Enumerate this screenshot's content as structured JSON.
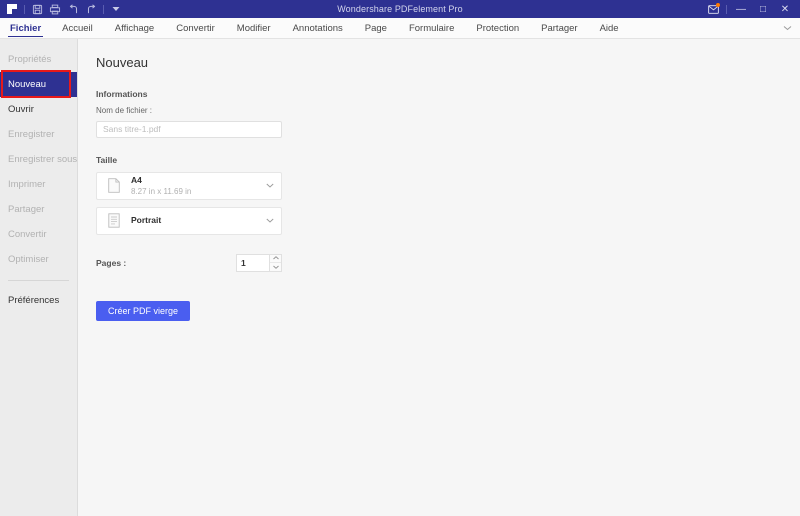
{
  "titlebar": {
    "app_title": "Wondershare PDFelement Pro",
    "quick_icons": [
      {
        "name": "app-logo-icon",
        "label": "PDFelement"
      },
      {
        "name": "save-icon",
        "label": "Enregistrer"
      },
      {
        "name": "print-icon",
        "label": "Imprimer"
      },
      {
        "name": "undo-icon",
        "label": "Annuler"
      },
      {
        "name": "redo-icon",
        "label": "Rétablir"
      },
      {
        "name": "quick-access-dropdown-icon",
        "label": "Personnaliser"
      }
    ],
    "mail_icon": "mail-icon",
    "notification_badge_color": "#ff7a00",
    "minimize_label": "—",
    "maximize_label": "□",
    "close_label": "✕",
    "background_color": "#2e3192"
  },
  "menubar": {
    "items": [
      {
        "label": "Fichier",
        "active": true
      },
      {
        "label": "Accueil",
        "active": false
      },
      {
        "label": "Affichage",
        "active": false
      },
      {
        "label": "Convertir",
        "active": false
      },
      {
        "label": "Modifier",
        "active": false
      },
      {
        "label": "Annotations",
        "active": false
      },
      {
        "label": "Page",
        "active": false
      },
      {
        "label": "Formulaire",
        "active": false
      },
      {
        "label": "Protection",
        "active": false
      },
      {
        "label": "Partager",
        "active": false
      },
      {
        "label": "Aide",
        "active": false
      }
    ],
    "collapse_icon": "chevron-down-icon",
    "accent_color": "#2e3192"
  },
  "sidebar": {
    "items": [
      {
        "label": "Propriétés",
        "state": "disabled"
      },
      {
        "label": "Nouveau",
        "state": "selected"
      },
      {
        "label": "Ouvrir",
        "state": "enabled"
      },
      {
        "label": "Enregistrer",
        "state": "disabled"
      },
      {
        "label": "Enregistrer sous",
        "state": "disabled"
      },
      {
        "label": "Imprimer",
        "state": "disabled"
      },
      {
        "label": "Partager",
        "state": "disabled"
      },
      {
        "label": "Convertir",
        "state": "disabled"
      },
      {
        "label": "Optimiser",
        "state": "disabled"
      }
    ],
    "footer_item": {
      "label": "Préférences",
      "state": "enabled"
    },
    "selected_background": "#2e3192",
    "highlight_border_color": "#e8191a"
  },
  "main": {
    "page_title": "Nouveau",
    "informations": {
      "section_label": "Informations",
      "filename_label": "Nom de fichier :",
      "filename_value": "",
      "filename_placeholder": "Sans titre-1.pdf"
    },
    "taille": {
      "section_label": "Taille",
      "size_select": {
        "icon": "blank-page-icon",
        "value": "A4",
        "dimensions": "8.27 in x 11.69 in",
        "chevron": "chevron-down-icon"
      },
      "orientation_select": {
        "icon": "portrait-page-icon",
        "value": "Portrait",
        "chevron": "chevron-down-icon"
      }
    },
    "pages": {
      "label": "Pages :",
      "value": "1",
      "increment_icon": "caret-up-icon",
      "decrement_icon": "caret-down-icon"
    },
    "create_button": {
      "label": "Créer PDF vierge",
      "color": "#4a5ef0"
    }
  }
}
